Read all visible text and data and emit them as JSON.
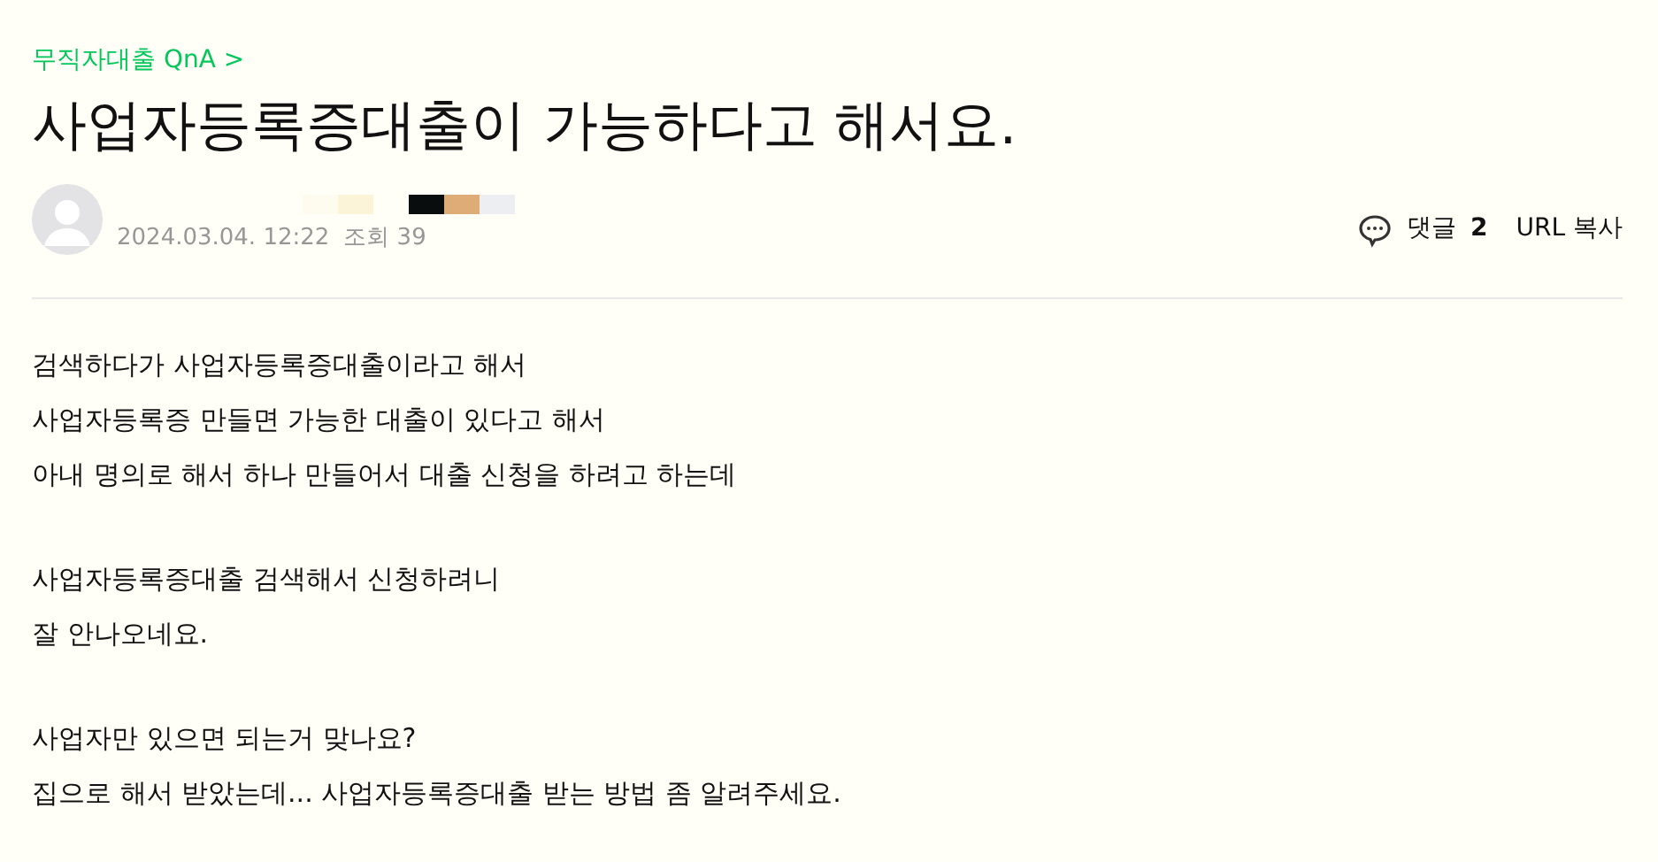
{
  "breadcrumb": {
    "label": "무직자대출 QnA",
    "chevron": ">"
  },
  "title": "사업자등록증대출이 가능하다고 해서요.",
  "author": {
    "name_blocks": [
      {
        "color": "#fefcee"
      },
      {
        "color": "#fbf4d8"
      },
      {
        "color": "#0a0d0e"
      },
      {
        "color": "#deac76"
      },
      {
        "color": "#eceef2"
      }
    ],
    "date": "2024.03.04. 12:22",
    "views": "조회 39"
  },
  "actions": {
    "comments_label": "댓글",
    "comments_count": "2",
    "copy_url": "URL 복사"
  },
  "body": [
    [
      "검색하다가 사업자등록증대출이라고 해서",
      "사업자등록증 만들면 가능한 대출이 있다고 해서",
      "아내 명의로 해서 하나 만들어서 대출 신청을 하려고 하는데"
    ],
    [
      "사업자등록증대출 검색해서 신청하려니",
      "잘 안나오네요."
    ],
    [
      "사업자만 있으면 되는거 맞나요?",
      "집으로 해서 받았는데... 사업자등록증대출 받는 방법 좀 알려주세요."
    ]
  ]
}
